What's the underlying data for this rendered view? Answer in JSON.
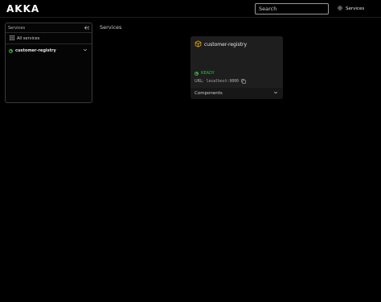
{
  "header": {
    "logo": "AKKA",
    "search_placeholder": "Search",
    "services_label": "Services"
  },
  "sidebar": {
    "title": "Services",
    "all_services_label": "All services",
    "items": [
      {
        "label": "customer-registry",
        "status_color": "#39b54a"
      }
    ]
  },
  "main": {
    "title": "Services",
    "card": {
      "name": "customer-registry",
      "status": "READY",
      "url_label": "URL:",
      "url_value": "localhost:9000",
      "footer_label": "Components",
      "accent_color": "#f0b400"
    }
  }
}
